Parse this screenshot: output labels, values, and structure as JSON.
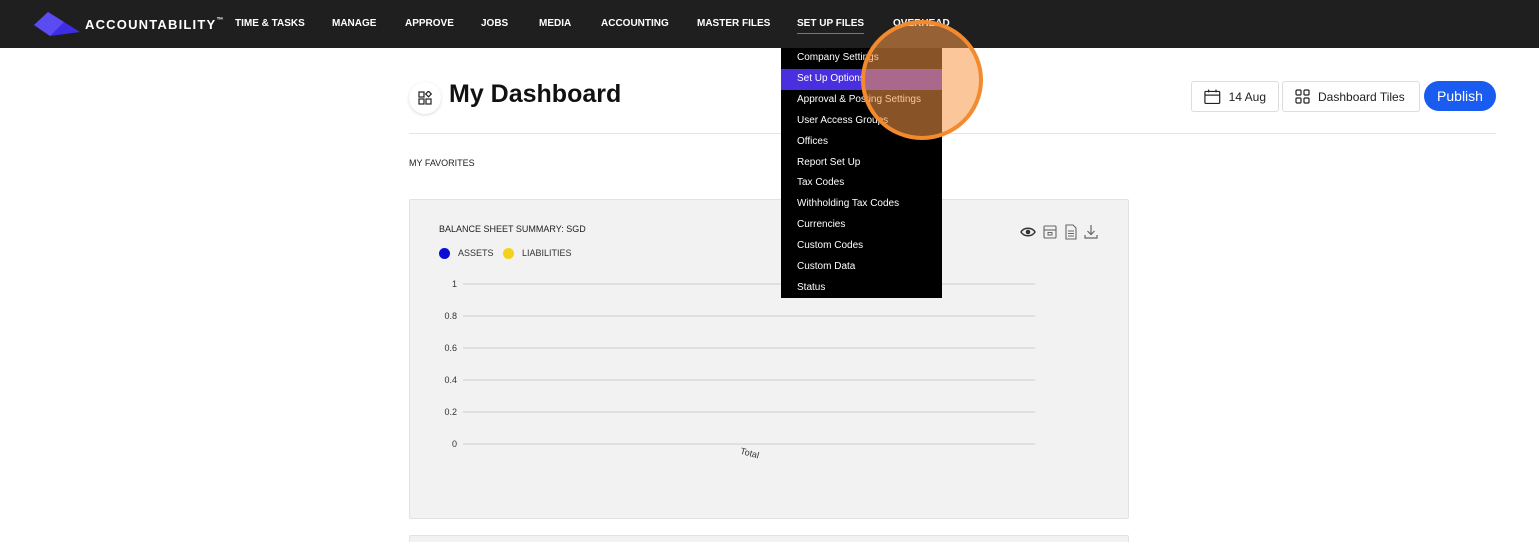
{
  "app": {
    "brand_main": "ACCOUNTABILITY",
    "brand_tm": "™",
    "brand_color": "#3d2ee6"
  },
  "nav": {
    "items": [
      {
        "label": "TIME & TASKS"
      },
      {
        "label": "MANAGE"
      },
      {
        "label": "APPROVE"
      },
      {
        "label": "JOBS"
      },
      {
        "label": "MEDIA"
      },
      {
        "label": "ACCOUNTING"
      },
      {
        "label": "MASTER FILES"
      },
      {
        "label": "SET UP FILES",
        "active": true
      },
      {
        "label": "OVERHEAD"
      }
    ]
  },
  "dropdown": {
    "items": [
      {
        "label": "Company Settings"
      },
      {
        "label": "Set Up Options",
        "highlighted": true
      },
      {
        "label": "Approval & Posting Settings"
      },
      {
        "label": "User Access Groups"
      },
      {
        "label": "Offices"
      },
      {
        "label": "Report Set Up"
      },
      {
        "label": "Tax Codes"
      },
      {
        "label": "Withholding Tax Codes"
      },
      {
        "label": "Currencies"
      },
      {
        "label": "Custom Codes"
      },
      {
        "label": "Custom Data"
      },
      {
        "label": "Status"
      }
    ]
  },
  "header": {
    "title": "My Dashboard",
    "date_label": "14 Aug",
    "tiles_label": "Dashboard Tiles",
    "publish_label": "Publish"
  },
  "favorites": {
    "label": "MY FAVORITES"
  },
  "tile": {
    "title": "BALANCE SHEET SUMMARY: SGD",
    "tools": [
      "eye-icon",
      "archive-icon",
      "document-icon",
      "download-icon"
    ]
  },
  "chart_data": {
    "type": "bar",
    "categories": [
      "Total"
    ],
    "series": [
      {
        "name": "ASSETS",
        "color": "#0b0bd6",
        "values": [
          0
        ]
      },
      {
        "name": "LIABILITIES",
        "color": "#f2d21b",
        "values": [
          0
        ]
      }
    ],
    "yticks": [
      "1",
      "0.8",
      "0.6",
      "0.4",
      "0.2",
      "0"
    ],
    "ylim": [
      0,
      1
    ],
    "grid": true,
    "legend": "top-left"
  }
}
